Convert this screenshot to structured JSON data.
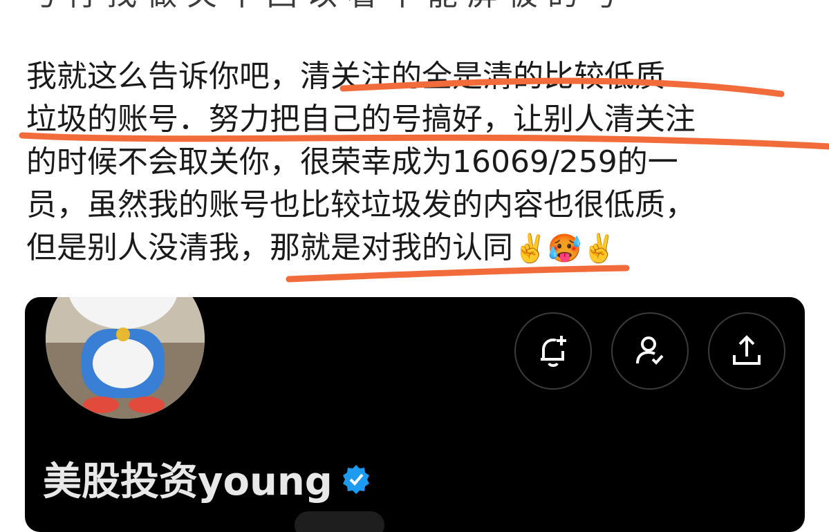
{
  "post": {
    "cut_line": "与 行 找 做 关 不 回 以 看 不 能 屏 被 的 号",
    "line1_pre": "我就这么告诉你吧，",
    "line1_hl": "清关注的全是清的比较低质",
    "line2": "垃圾的账号．努力把自己的号搞好，让别人清关注",
    "line3": "的时候不会取关你，很荣幸成为16069/259的一",
    "line4": "员，虽然我的账号也比较垃圾发的内容也很低质，",
    "line5_pre": "但是别人没清我，",
    "line5_hl": "那就是对我的认同",
    "emojis": "✌️🥵✌️"
  },
  "card": {
    "profile_name": "美股投资young",
    "buttons": [
      "bell-plus-icon",
      "user-check-icon",
      "share-icon"
    ],
    "verified_color": "#1d9bf0",
    "annotation_color": "#f26b3a"
  }
}
